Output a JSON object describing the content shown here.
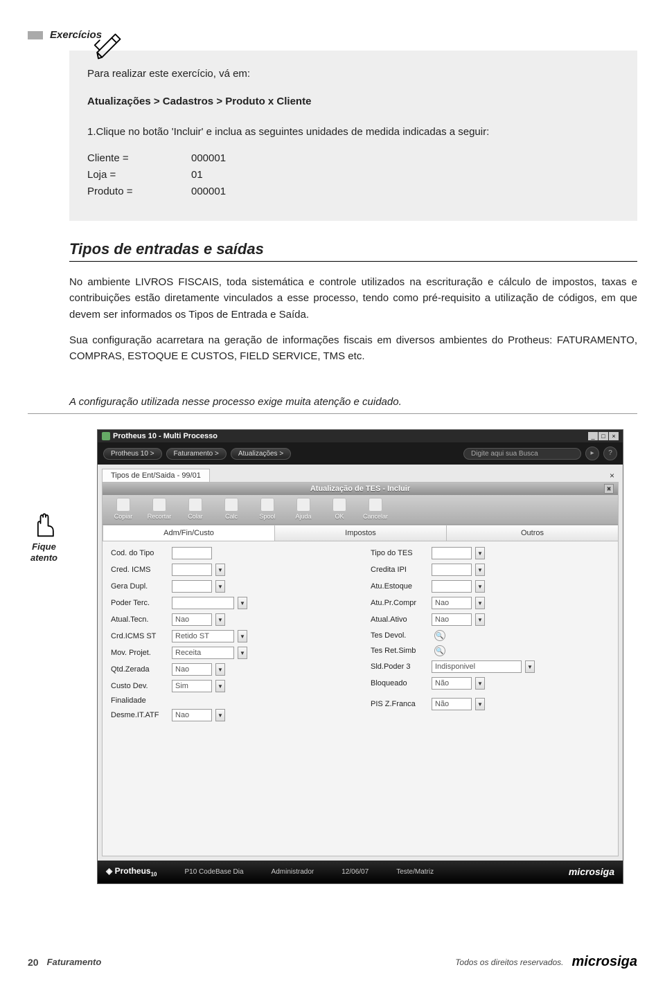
{
  "header": {
    "exercisesLabel": "Exercícios"
  },
  "exercise": {
    "intro": "Para realizar este exercício, vá em:",
    "navpath": "Atualizações > Cadastros > Produto x Cliente",
    "step1": "1.Clique no botão 'Incluir' e inclua as seguintes unidades de medida indicadas a seguir:",
    "rows": [
      {
        "label": "Cliente =",
        "value": "000001"
      },
      {
        "label": "Loja =",
        "value": "01"
      },
      {
        "label": "Produto =",
        "value": "000001"
      }
    ]
  },
  "section": {
    "title": "Tipos de entradas e saídas",
    "p1": "No ambiente LIVROS FISCAIS, toda sistemática e controle utilizados na escrituração e cálculo de impostos, taxas e contribuições estão diretamente vinculados a esse processo, tendo como pré-requisito a utilização de códigos, em que devem ser informados os Tipos de Entrada e Saída.",
    "p2": "Sua configuração acarretara na geração de informações fiscais em diversos ambientes do Protheus: FATURAMENTO, COMPRAS, ESTOQUE E CUSTOS, FIELD SERVICE, TMS etc."
  },
  "attention": {
    "label1": "Fique",
    "label2": "atento",
    "text": "A configuração utilizada nesse processo exige muita atenção e cuidado."
  },
  "app": {
    "title": "Protheus 10 - Multi Processo",
    "crumbs": [
      "Protheus 10 >",
      "Faturamento >",
      "Atualizações >"
    ],
    "searchPlaceholder": "Digite aqui sua Busca",
    "docTab": "Tipos de Ent/Saida - 99/01",
    "innerTitle": "Atualização de TES - Incluir",
    "toolbar": [
      "Copiar",
      "Recortar",
      "Colar",
      "Calc",
      "Spool",
      "Ajuda",
      "OK",
      "Cancelar"
    ],
    "formTabs": [
      "Adm/Fin/Custo",
      "Impostos",
      "Outros"
    ],
    "fieldsLeft": [
      {
        "label": "Cod. do Tipo",
        "value": "",
        "size": "sm",
        "dd": false
      },
      {
        "label": "Cred. ICMS",
        "value": "",
        "size": "sm",
        "dd": true
      },
      {
        "label": "Gera Dupl.",
        "value": "",
        "size": "sm",
        "dd": true
      },
      {
        "label": "Poder Terc.",
        "value": "",
        "size": "md",
        "dd": true
      },
      {
        "label": "Atual.Tecn.",
        "value": "Nao",
        "size": "sm",
        "dd": true
      },
      {
        "label": "Crd.ICMS ST",
        "value": "Retido ST",
        "size": "md",
        "dd": true
      },
      {
        "label": "Mov. Projet.",
        "value": "Receita",
        "size": "md",
        "dd": true
      },
      {
        "label": "Qtd.Zerada",
        "value": "Nao",
        "size": "sm",
        "dd": true
      },
      {
        "label": "Custo Dev.",
        "value": "Sim",
        "size": "sm",
        "dd": true
      },
      {
        "label": "Finalidade",
        "value": "",
        "size": "none",
        "dd": false
      },
      {
        "label": "Desme.IT.ATF",
        "value": "Nao",
        "size": "sm",
        "dd": true
      }
    ],
    "fieldsRight": [
      {
        "label": "Tipo do TES",
        "value": "",
        "size": "sm",
        "dd": true,
        "mag": false
      },
      {
        "label": "Credita IPI",
        "value": "",
        "size": "sm",
        "dd": true,
        "mag": false
      },
      {
        "label": "Atu.Estoque",
        "value": "",
        "size": "sm",
        "dd": true,
        "mag": false
      },
      {
        "label": "Atu.Pr.Compr",
        "value": "Nao",
        "size": "sm",
        "dd": true,
        "mag": false
      },
      {
        "label": "Atual.Ativo",
        "value": "Nao",
        "size": "sm",
        "dd": true,
        "mag": false
      },
      {
        "label": "Tes Devol.",
        "value": "",
        "size": "none",
        "dd": false,
        "mag": true
      },
      {
        "label": "Tes Ret.Simb",
        "value": "",
        "size": "none",
        "dd": false,
        "mag": true
      },
      {
        "label": "Sld.Poder 3",
        "value": "Indisponivel",
        "size": "lg",
        "dd": true,
        "mag": false
      },
      {
        "label": "Bloqueado",
        "value": "Não",
        "size": "sm",
        "dd": true,
        "mag": false
      },
      {
        "label": "",
        "value": "",
        "size": "none",
        "dd": false,
        "mag": false
      },
      {
        "label": "PIS Z.Franca",
        "value": "Não",
        "size": "sm",
        "dd": true,
        "mag": false
      }
    ],
    "status": {
      "logo": "Protheus",
      "logoSub": "10",
      "items": [
        "P10 CodeBase Dia",
        "Administrador",
        "12/06/07",
        "Teste/Matriz"
      ],
      "brand": "microsiga"
    }
  },
  "footer": {
    "page": "20",
    "title": "Faturamento",
    "rights": "Todos os direitos reservados.",
    "brand": "microsiga"
  }
}
